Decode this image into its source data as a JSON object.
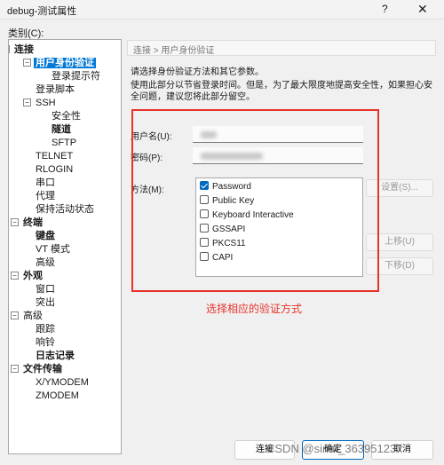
{
  "window": {
    "title": "debug-测试属性",
    "help_glyph": "?",
    "close_glyph": "✕"
  },
  "category_label": "类别(C):",
  "tree": {
    "nodes": [
      {
        "label": "连接",
        "bold": true,
        "expander": "−"
      },
      {
        "label": "用户身份验证",
        "bold": true,
        "selected": true,
        "expander": "−"
      },
      {
        "label": "登录提示符"
      },
      {
        "label": "登录脚本"
      },
      {
        "label": "SSH",
        "expander": "−"
      },
      {
        "label": "安全性"
      },
      {
        "label": "隧道",
        "bold": true
      },
      {
        "label": "SFTP"
      },
      {
        "label": "TELNET"
      },
      {
        "label": "RLOGIN"
      },
      {
        "label": "串口"
      },
      {
        "label": "代理"
      },
      {
        "label": "保持活动状态"
      },
      {
        "label": "终端",
        "bold": true,
        "expander": "−"
      },
      {
        "label": "键盘",
        "bold": true
      },
      {
        "label": "VT 模式"
      },
      {
        "label": "高级"
      },
      {
        "label": "外观",
        "bold": true,
        "expander": "−"
      },
      {
        "label": "窗口"
      },
      {
        "label": "突出"
      },
      {
        "label": "高级",
        "expander": "−"
      },
      {
        "label": "跟踪"
      },
      {
        "label": "响铃"
      },
      {
        "label": "日志记录",
        "bold": true
      },
      {
        "label": "文件传输",
        "bold": true,
        "expander": "−"
      },
      {
        "label": "X/YMODEM"
      },
      {
        "label": "ZMODEM"
      }
    ]
  },
  "breadcrumb": "连接 > 用户身份验证",
  "description": {
    "line1": "请选择身份验证方法和其它参数。",
    "line2": "使用此部分以节省登录时间。但是，为了最大限度地提高安全性，如果担心安全问题，建议您将此部分留空。"
  },
  "form": {
    "username_label": "用户名(U):",
    "password_label": "密码(P):",
    "method_label": "方法(M):"
  },
  "methods": [
    {
      "label": "Password",
      "checked": true
    },
    {
      "label": "Public Key",
      "checked": false
    },
    {
      "label": "Keyboard Interactive",
      "checked": false
    },
    {
      "label": "GSSAPI",
      "checked": false
    },
    {
      "label": "PKCS11",
      "checked": false
    },
    {
      "label": "CAPI",
      "checked": false
    }
  ],
  "side_buttons": {
    "settings": "设置(S)...",
    "move_up": "上移(U)",
    "move_down": "下移(D)"
  },
  "annotation": "选择相应的验证方式",
  "bottom_buttons": {
    "connect": "连接",
    "ok": "确定",
    "cancel": "取消"
  },
  "watermark": "CSDN @sinat_36395123",
  "colors": {
    "accent": "#0067c0",
    "annotation_red": "#e8332a",
    "tree_selection": "#0078d7"
  }
}
